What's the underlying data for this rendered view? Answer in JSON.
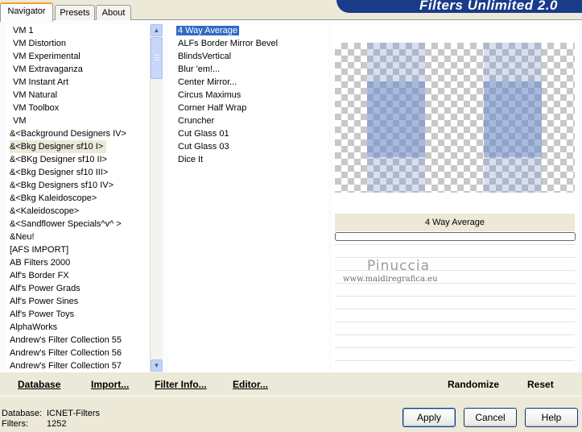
{
  "app": {
    "title": "Filters Unlimited 2.0"
  },
  "tabs": [
    {
      "label": "Navigator"
    },
    {
      "label": "Presets"
    },
    {
      "label": "About"
    }
  ],
  "categories": [
    "VM 1",
    "VM Distortion",
    "VM Experimental",
    "VM Extravaganza",
    "VM Instant Art",
    "VM Natural",
    "VM Toolbox",
    "VM",
    "&<Background Designers IV>",
    "&<Bkg Designer sf10 I>",
    "&<BKg Designer sf10 II>",
    "&<Bkg Designer sf10 III>",
    "&<Bkg Designers sf10 IV>",
    "&<Bkg Kaleidoscope>",
    "&<Kaleidoscope>",
    "&<Sandflower Specials^v^ >",
    "&Neu!",
    "[AFS IMPORT]",
    "AB Filters 2000",
    "Alf's Border FX",
    "Alf's Power Grads",
    "Alf's Power Sines",
    "Alf's Power Toys",
    "AlphaWorks",
    "Andrew's Filter Collection 55",
    "Andrew's Filter Collection 56",
    "Andrew's Filter Collection 57"
  ],
  "selected_category": "&<Bkg Designer sf10 I>",
  "filters": [
    "4 Way Average",
    "ALFs Border Mirror Bevel",
    "BlindsVertical",
    "Blur 'em!...",
    "Center Mirror...",
    "Circus Maximus",
    "Corner Half Wrap",
    "Cruncher",
    "Cut Glass  01",
    "Cut Glass  03",
    "Dice It"
  ],
  "selected_filter": "4 Way Average",
  "preview": {
    "filter_name": "4 Way Average"
  },
  "watermark": {
    "name": "Pinuccia",
    "url": "www.maidiregrafica.eu"
  },
  "toolbar": {
    "database": "Database",
    "import": "Import...",
    "filter_info": "Filter Info...",
    "editor": "Editor...",
    "randomize": "Randomize",
    "reset": "Reset"
  },
  "status": {
    "database_label": "Database:",
    "database_value": "ICNET-Filters",
    "filters_label": "Filters:",
    "filters_value": "1252"
  },
  "buttons": {
    "apply": "Apply",
    "cancel": "Cancel",
    "help": "Help"
  },
  "colors": {
    "selection": "#316ac5",
    "banner": "#1a3a8a",
    "tab_accent": "#f0a030"
  }
}
